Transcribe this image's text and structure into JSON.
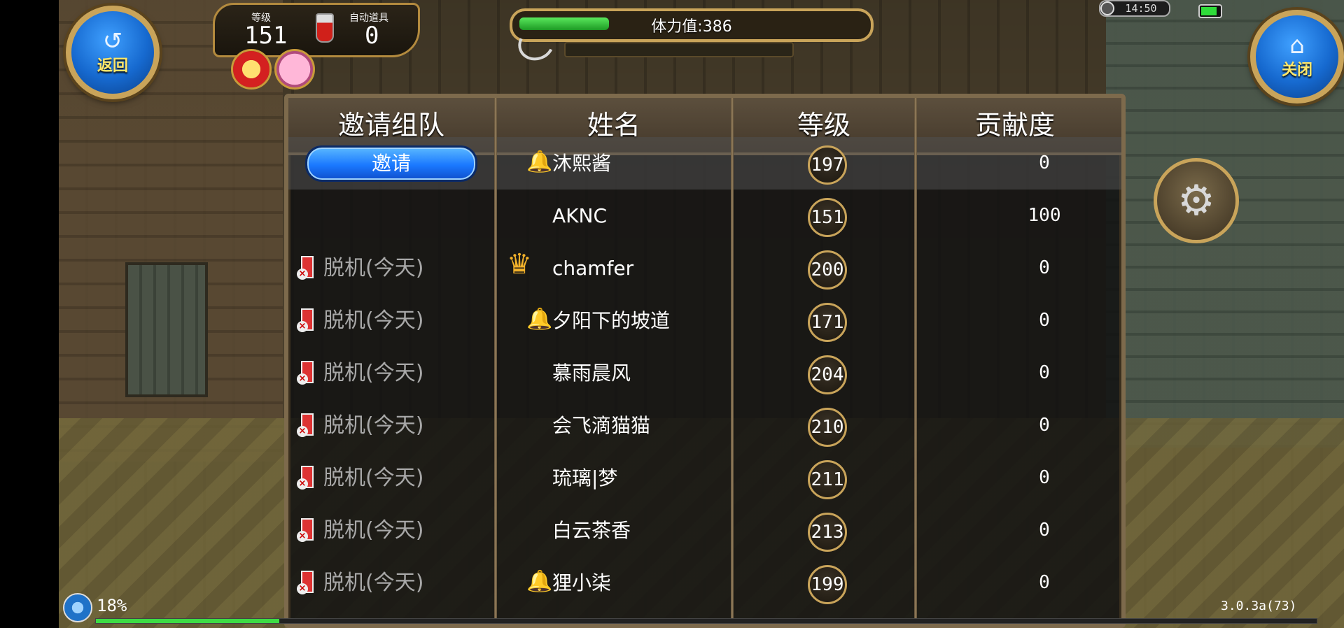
{
  "hud": {
    "back_label": "返回",
    "close_label": "关闭",
    "level_caption": "等级",
    "level_value": "151",
    "auto_item_caption": "自动道具",
    "auto_item_value": "0",
    "stamina_text": "体力值:386",
    "stamina_fraction": 0.25,
    "clock": "14:50",
    "network_percent": "18%",
    "exp_fraction": 0.15,
    "version": "3.0.3a(73)"
  },
  "table": {
    "headers": [
      "邀请组队",
      "姓名",
      "等级",
      "贡献度"
    ],
    "invite_label": "邀请",
    "rows": [
      {
        "status": "",
        "role": "bell",
        "name": "沐熙酱",
        "level": "197",
        "contribution": "0",
        "invite": true
      },
      {
        "status": "",
        "role": "",
        "name": "AKNC",
        "level": "151",
        "contribution": "100",
        "invite": false
      },
      {
        "status": "脱机(今天)",
        "role": "crown",
        "name": "chamfer",
        "level": "200",
        "contribution": "0",
        "invite": false
      },
      {
        "status": "脱机(今天)",
        "role": "bell",
        "name": "夕阳下的坡道",
        "level": "171",
        "contribution": "0",
        "invite": false
      },
      {
        "status": "脱机(今天)",
        "role": "",
        "name": "慕雨晨风",
        "level": "204",
        "contribution": "0",
        "invite": false
      },
      {
        "status": "脱机(今天)",
        "role": "",
        "name": "会飞滴猫猫",
        "level": "210",
        "contribution": "0",
        "invite": false
      },
      {
        "status": "脱机(今天)",
        "role": "",
        "name": "琉璃|梦",
        "level": "211",
        "contribution": "0",
        "invite": false
      },
      {
        "status": "脱机(今天)",
        "role": "",
        "name": "白云茶香",
        "level": "213",
        "contribution": "0",
        "invite": false
      },
      {
        "status": "脱机(今天)",
        "role": "bell",
        "name": "狸小柒",
        "level": "199",
        "contribution": "0",
        "invite": false
      }
    ]
  },
  "icons": {
    "back": "back-arrow-icon",
    "close": "home-icon",
    "settings": "gears-icon",
    "bell": "bell-icon",
    "crown": "crown-icon",
    "offline": "offline-card-icon"
  }
}
